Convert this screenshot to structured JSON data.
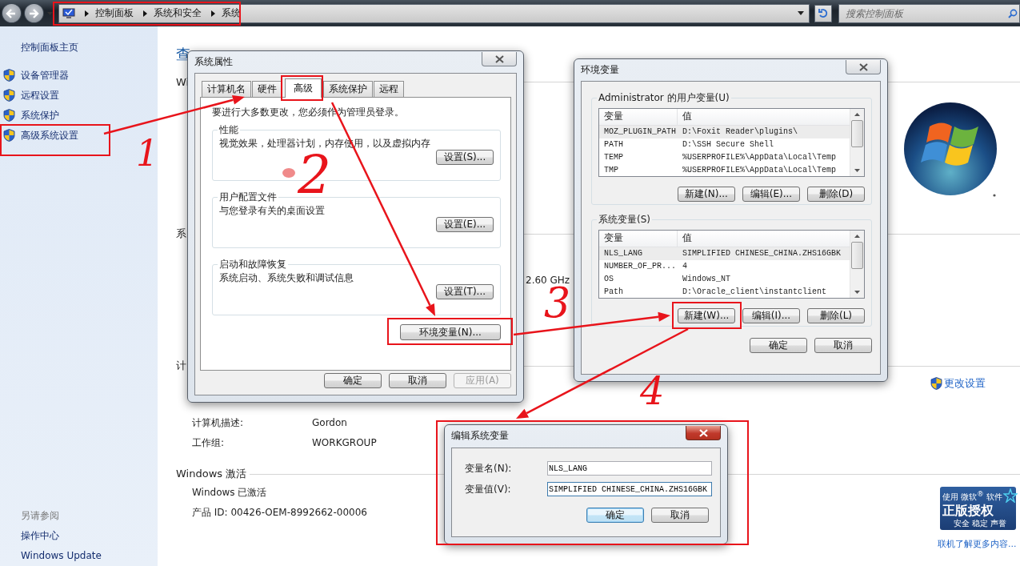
{
  "toolbar": {
    "breadcrumbs": [
      "控制面板",
      "系统和安全",
      "系统"
    ],
    "search_placeholder": "搜索控制面板"
  },
  "sidebar": {
    "home": "控制面板主页",
    "tasks": [
      "设备管理器",
      "远程设置",
      "系统保护",
      "高级系统设置"
    ],
    "see_also_title": "另请参阅",
    "see_also": [
      "操作中心",
      "Windows Update"
    ]
  },
  "main": {
    "heading_fragment": "查",
    "sections": [
      {
        "title": "Wi"
      },
      {
        "title": "系"
      },
      {
        "title": "计"
      },
      {
        "title": "Windows 激活"
      }
    ],
    "cpu_fragment": "2.60 GHz",
    "computer_rows": [
      {
        "label": "计算机描述:",
        "value": "Gordon"
      },
      {
        "label": "工作组:",
        "value": "WORKGROUP"
      }
    ],
    "change_settings": "更改设置",
    "activation": {
      "status": "Windows 已激活",
      "product_id": "产品 ID: 00426-OEM-8992662-00006"
    },
    "genuine_badge": {
      "line_1": "使用 微软$^{®}$ 软件",
      "line_2": "正版授权",
      "line_3": "安全 稳定 声誉"
    },
    "learn_more": "联机了解更多内容..."
  },
  "system_properties": {
    "title": "系统属性",
    "tabs": [
      {
        "label": "计算机名",
        "selected": false
      },
      {
        "label": "硬件",
        "selected": false
      },
      {
        "label": "高级",
        "selected": true
      },
      {
        "label": "系统保护",
        "selected": false
      },
      {
        "label": "远程",
        "selected": false
      }
    ],
    "admin_note": "要进行大多数更改，您必须作为管理员登录。",
    "groups": [
      {
        "title": "性能",
        "description": "视觉效果，处理器计划，内存使用，以及虚拟内存",
        "button": "设置(S)..."
      },
      {
        "title": "用户配置文件",
        "description": "与您登录有关的桌面设置",
        "button": "设置(E)..."
      },
      {
        "title": "启动和故障恢复",
        "description": "系统启动、系统失败和调试信息",
        "button": "设置(T)..."
      }
    ],
    "env_button": "环境变量(N)...",
    "buttons": [
      {
        "label": "确定",
        "disabled": false
      },
      {
        "label": "取消",
        "disabled": false
      },
      {
        "label": "应用(A)",
        "disabled": true
      }
    ]
  },
  "env_vars": {
    "title": "环境变量",
    "lists": [
      {
        "title": "Administrator 的用户变量(U)",
        "columns": [
          "变量",
          "值"
        ],
        "rows": [
          {
            "name": "MOZ_PLUGIN_PATH",
            "value": "D:\\Foxit Reader\\plugins\\",
            "selected": true
          },
          {
            "name": "PATH",
            "value": "D:\\SSH Secure Shell",
            "selected": false
          },
          {
            "name": "TEMP",
            "value": "%USERPROFILE%\\AppData\\Local\\Temp",
            "selected": false
          },
          {
            "name": "TMP",
            "value": "%USERPROFILE%\\AppData\\Local\\Temp",
            "selected": false
          }
        ],
        "buttons": [
          "新建(N)...",
          "编辑(E)...",
          "删除(D)"
        ]
      },
      {
        "title": "系统变量(S)",
        "columns": [
          "变量",
          "值"
        ],
        "rows": [
          {
            "name": "NLS_LANG",
            "value": "SIMPLIFIED CHINESE_CHINA.ZHS16GBK",
            "selected": true
          },
          {
            "name": "NUMBER_OF_PR...",
            "value": "4",
            "selected": false
          },
          {
            "name": "OS",
            "value": "Windows_NT",
            "selected": false
          },
          {
            "name": "Path",
            "value": "D:\\Oracle_client\\instantclient",
            "selected": false
          }
        ],
        "buttons": [
          "新建(W)...",
          "编辑(I)...",
          "删除(L)"
        ]
      }
    ],
    "buttons": [
      "确定",
      "取消"
    ]
  },
  "edit_dialog": {
    "title": "编辑系统变量",
    "fields": [
      {
        "label": "变量名(N):",
        "value": "NLS_LANG",
        "focused": false
      },
      {
        "label": "变量值(V):",
        "value": "SIMPLIFIED CHINESE_CHINA.ZHS16GBK",
        "focused": true
      }
    ],
    "buttons": [
      {
        "label": "确定",
        "default": true
      },
      {
        "label": "取消",
        "default": false
      }
    ]
  },
  "annotations": [
    {
      "text": "1"
    },
    {
      "text": "2"
    },
    {
      "text": "3"
    },
    {
      "text": "4"
    }
  ]
}
